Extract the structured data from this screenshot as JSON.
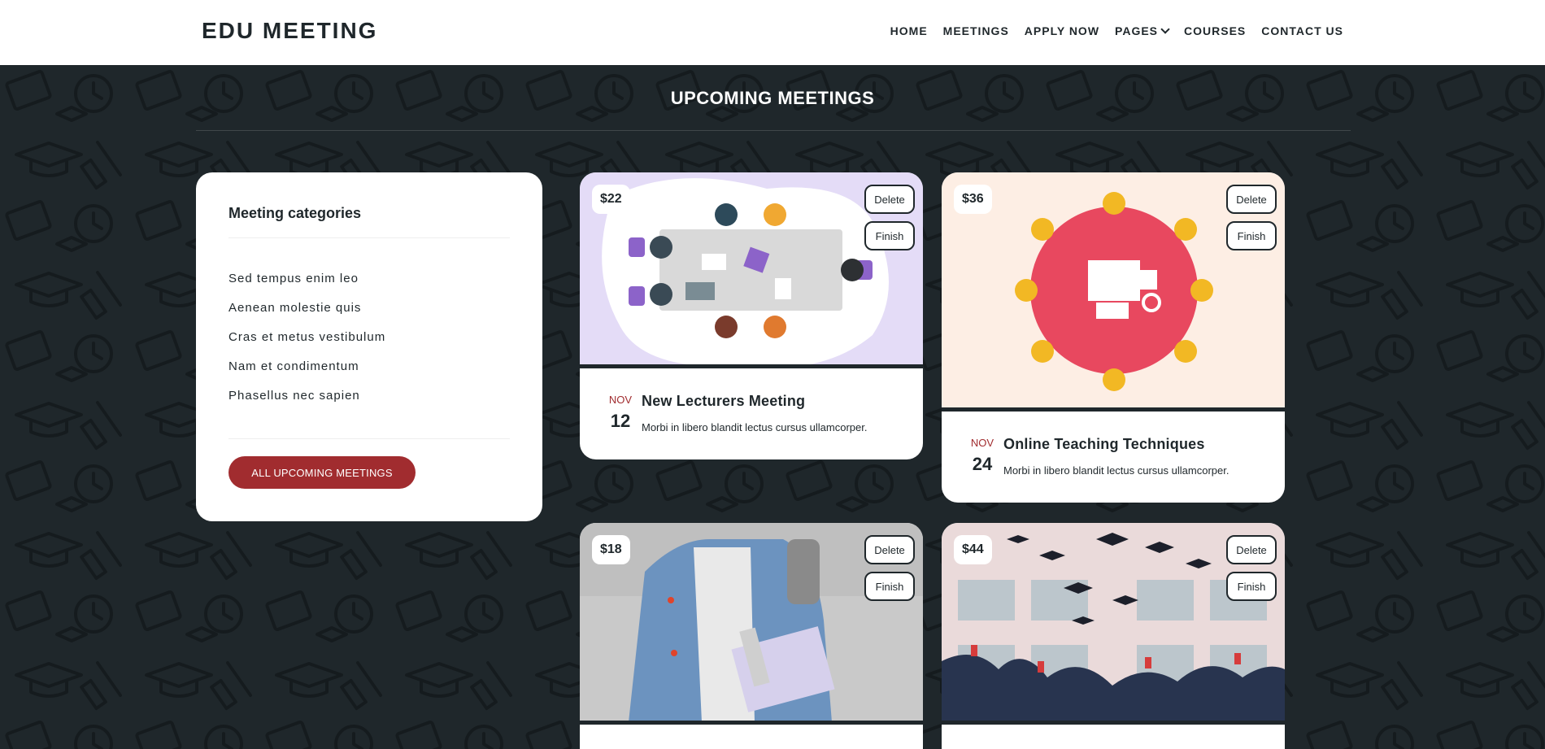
{
  "header": {
    "logo": "EDU MEETING",
    "nav": [
      "HOME",
      "MEETINGS",
      "APPLY NOW",
      "PAGES",
      "COURSES",
      "CONTACT US"
    ]
  },
  "section": {
    "title": "UPCOMING MEETINGS"
  },
  "categories": {
    "title": "Meeting categories",
    "items": [
      "Sed tempus enim leo",
      "Aenean molestie quis",
      "Cras et metus vestibulum",
      "Nam et condimentum",
      "Phasellus nec sapien"
    ],
    "button": "ALL UPCOMING MEETINGS"
  },
  "meetings": [
    {
      "price": "$22",
      "delete": "Delete",
      "finish": "Finish",
      "month": "NOV",
      "day": "12",
      "title": "New Lecturers Meeting",
      "desc": "Morbi in libero blandit lectus cursus ullamcorper."
    },
    {
      "price": "$36",
      "delete": "Delete",
      "finish": "Finish",
      "month": "NOV",
      "day": "24",
      "title": "Online Teaching Techniques",
      "desc": "Morbi in libero blandit lectus cursus ullamcorper."
    },
    {
      "price": "$18",
      "delete": "Delete",
      "finish": "Finish"
    },
    {
      "price": "$44",
      "delete": "Delete",
      "finish": "Finish"
    }
  ],
  "colors": {
    "accent": "#a12c2f",
    "dark": "#1f272b",
    "background": "#1f272b"
  }
}
